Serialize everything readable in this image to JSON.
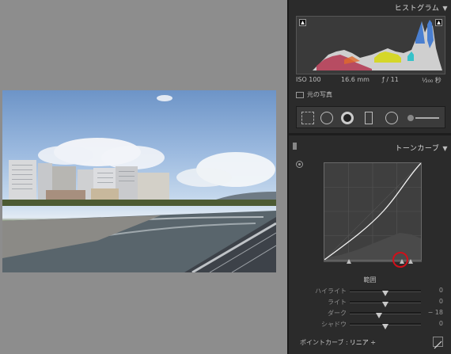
{
  "histogram": {
    "title": "ヒストグラム",
    "iso": "ISO 100",
    "focal_length": "16.6 mm",
    "aperture": "ƒ / 11",
    "shutter": "¹⁄₂₀₀ 秒",
    "original_photo_label": "元の写真"
  },
  "tone_curve": {
    "title": "トーンカーブ",
    "range_label": "範囲",
    "sliders": [
      {
        "label": "ハイライト",
        "value": "0",
        "position": 0.5
      },
      {
        "label": "ライト",
        "value": "0",
        "position": 0.5
      },
      {
        "label": "ダーク",
        "value": "− 18",
        "position": 0.41
      },
      {
        "label": "シャドウ",
        "value": "0",
        "position": 0.5
      }
    ],
    "split_points": [
      0.25,
      0.8,
      0.89
    ],
    "point_curve_label": "ポイントカーブ :",
    "point_curve_value": "リニア ÷"
  },
  "icons": [
    "clipping-shadow-icon",
    "clipping-highlight-icon",
    "crop-tool-icon",
    "spot-removal-icon",
    "redeye-icon",
    "graduated-filter-icon",
    "radial-filter-icon",
    "adjustment-brush-icon",
    "target-adjust-icon",
    "edit-point-curve-icon"
  ]
}
